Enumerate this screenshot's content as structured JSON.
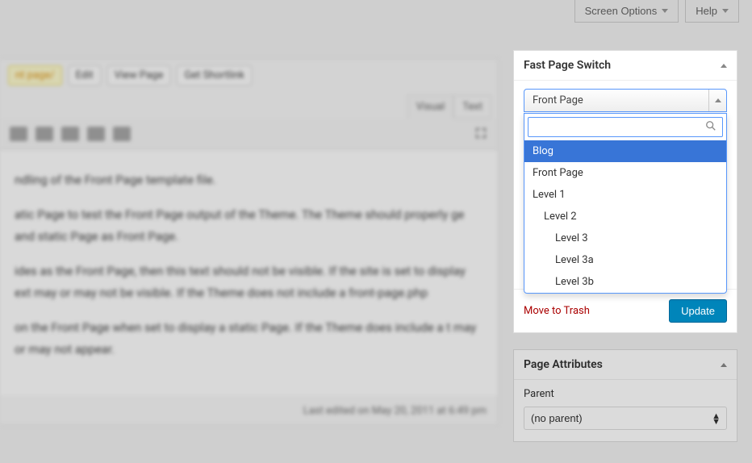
{
  "topbar": {
    "screen_options": "Screen Options",
    "help": "Help"
  },
  "editor": {
    "chips": [
      "nt page/",
      "Edit",
      "View Page",
      "Get Shortlink"
    ],
    "tabs": {
      "visual": "Visual",
      "text": "Text"
    },
    "body_lines": [
      "ndling of the Front Page template file.",
      "atic Page to test the Front Page output of the Theme. The Theme should properly ge and static Page as Front Page.",
      "ides as the Front Page, then this text should not be visible. If the site is set to display ext may or may not be visible. If the Theme does not include a front-page.php",
      "on the Front Page when set to display a static Page. If the Theme does include a t may or may not appear."
    ],
    "footer": "Last edited on May 20, 2011 at 6:49 pm"
  },
  "fast_page_switch": {
    "title": "Fast Page Switch",
    "selected": "Front Page",
    "search_placeholder": "",
    "options": [
      {
        "label": "Blog",
        "indent": 0,
        "highlighted": true
      },
      {
        "label": "Front Page",
        "indent": 0
      },
      {
        "label": "Level 1",
        "indent": 0
      },
      {
        "label": "Level 2",
        "indent": 1
      },
      {
        "label": "Level 3",
        "indent": 2
      },
      {
        "label": "Level 3a",
        "indent": 2
      },
      {
        "label": "Level 3b",
        "indent": 2
      }
    ]
  },
  "publish": {
    "trash": "Move to Trash",
    "update": "Update"
  },
  "attributes": {
    "title": "Page Attributes",
    "parent_label": "Parent",
    "parent_value": "(no parent)"
  }
}
